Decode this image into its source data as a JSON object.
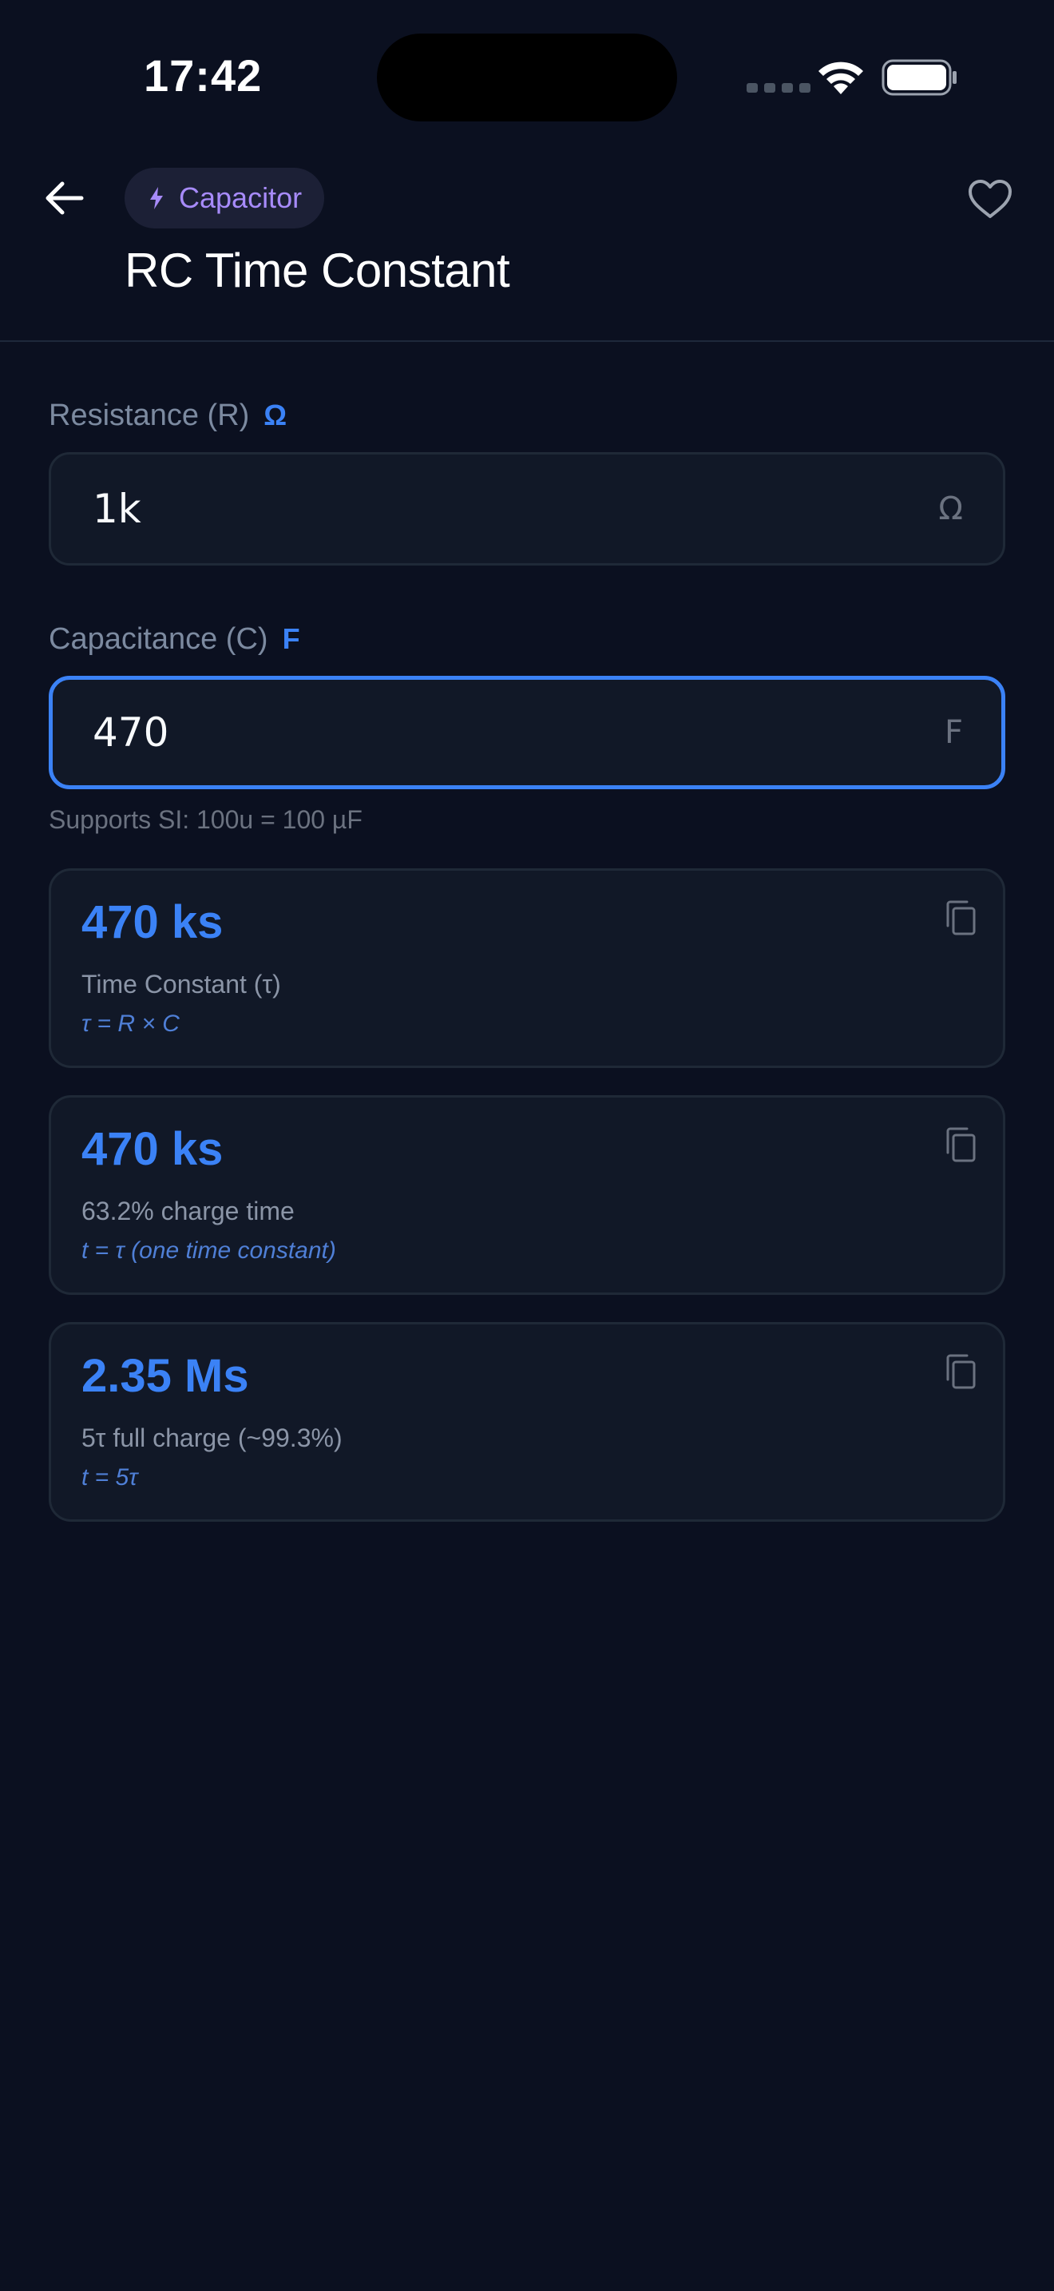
{
  "status_bar": {
    "time": "17:42"
  },
  "header": {
    "back_icon": "arrow-left-icon",
    "category": {
      "icon": "bolt-icon",
      "label": "Capacitor",
      "color": "#a78bfa"
    },
    "title": "RC Time Constant",
    "favorite_icon": "heart-outline-icon"
  },
  "fields": [
    {
      "label": "Resistance (R)",
      "unit": "Ω",
      "value": "1k",
      "suffix": "Ω",
      "focused": false
    },
    {
      "label": "Capacitance (C)",
      "unit": "F",
      "value": "470",
      "suffix": "F",
      "focused": true,
      "help": "Supports SI: 100u = 100 µF"
    }
  ],
  "results": [
    {
      "value": "470 ks",
      "label": "Time Constant (τ)",
      "formula": "τ = R × C",
      "copy_icon": "copy-icon"
    },
    {
      "value": "470 ks",
      "label": "63.2% charge time",
      "formula": "t = τ (one time constant)",
      "copy_icon": "copy-icon"
    },
    {
      "value": "2.35 Ms",
      "label": "5τ full charge (~99.3%)",
      "formula": "t = 5τ",
      "copy_icon": "copy-icon"
    }
  ],
  "colors": {
    "background": "#0b1020",
    "accent": "#3b82f6",
    "card": "#111827",
    "chip": "#1c2036"
  }
}
